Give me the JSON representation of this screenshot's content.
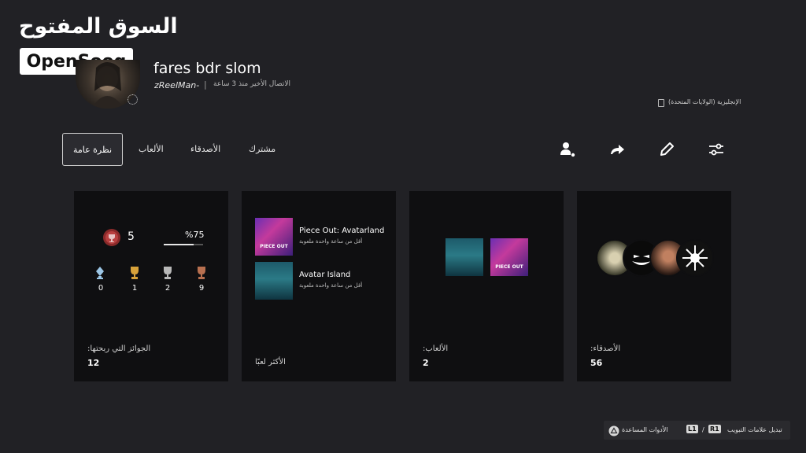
{
  "watermark": {
    "arabic": "السوق المفتوح",
    "latin": "OpenSooq"
  },
  "profile": {
    "name": "fares bdr slom",
    "online_id": "zReelMan-",
    "separator": "|",
    "last_seen": "الاتصال الأخير منذ 3 ساعة",
    "language": "الإنجليزية (الولايات المتحدة)"
  },
  "tabs": {
    "overview": "نظرة عامة",
    "games": "الألعاب",
    "friends": "الأصدقاء",
    "shared": "مشترك"
  },
  "actions": {
    "add_friend": "person-add-icon",
    "share": "share-icon",
    "edit": "edit-icon",
    "options": "options-icon"
  },
  "trophies": {
    "level": "5",
    "progress": "%75",
    "progress_fraction": 0.75,
    "platinum": "0",
    "gold": "1",
    "silver": "2",
    "bronze": "9",
    "label": "الجوائز التي ربحتها:",
    "total": "12"
  },
  "most_played": {
    "label": "الأكثر لعبًا",
    "games": [
      {
        "title": "Piece Out: Avatarland",
        "sub": "أقل من ساعة واحدة ملعوبة",
        "thumb_text": "PIECE OUT"
      },
      {
        "title": "Avatar Island",
        "sub": "أقل من ساعة واحدة ملعوبة"
      }
    ]
  },
  "games_card": {
    "label": "الألعاب:",
    "count": "2"
  },
  "friends_card": {
    "label": "الأصدقاء:",
    "count": "56"
  },
  "footer": {
    "switch_tabs": "تبديل علامات التبويب",
    "l1": "L1",
    "slash": "/",
    "r1": "R1",
    "help": "الأدوات المساعدة"
  },
  "colors": {
    "background": "#212125",
    "card": "#0f0f11",
    "gold": "#d8a23a",
    "silver": "#b8b8b8",
    "bronze": "#b87050",
    "platinum": "#9cc6e6"
  }
}
